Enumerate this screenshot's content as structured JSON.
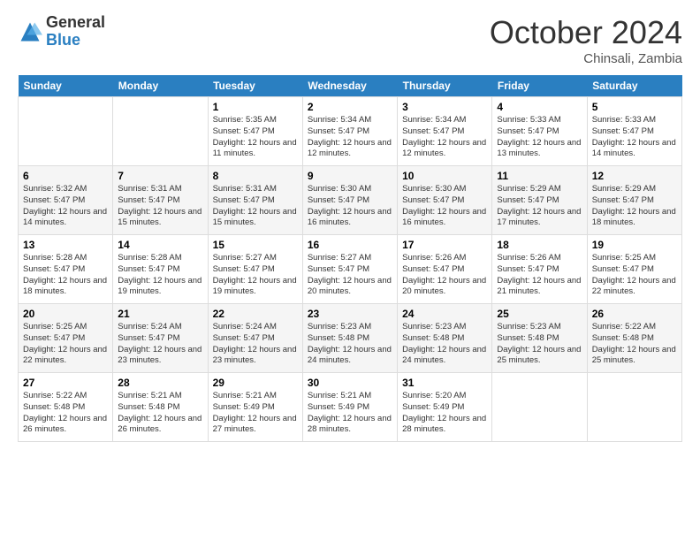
{
  "logo": {
    "general": "General",
    "blue": "Blue"
  },
  "header": {
    "month": "October 2024",
    "location": "Chinsali, Zambia"
  },
  "weekdays": [
    "Sunday",
    "Monday",
    "Tuesday",
    "Wednesday",
    "Thursday",
    "Friday",
    "Saturday"
  ],
  "weeks": [
    [
      {
        "day": "",
        "info": ""
      },
      {
        "day": "",
        "info": ""
      },
      {
        "day": "1",
        "info": "Sunrise: 5:35 AM\nSunset: 5:47 PM\nDaylight: 12 hours and 11 minutes."
      },
      {
        "day": "2",
        "info": "Sunrise: 5:34 AM\nSunset: 5:47 PM\nDaylight: 12 hours and 12 minutes."
      },
      {
        "day": "3",
        "info": "Sunrise: 5:34 AM\nSunset: 5:47 PM\nDaylight: 12 hours and 12 minutes."
      },
      {
        "day": "4",
        "info": "Sunrise: 5:33 AM\nSunset: 5:47 PM\nDaylight: 12 hours and 13 minutes."
      },
      {
        "day": "5",
        "info": "Sunrise: 5:33 AM\nSunset: 5:47 PM\nDaylight: 12 hours and 14 minutes."
      }
    ],
    [
      {
        "day": "6",
        "info": "Sunrise: 5:32 AM\nSunset: 5:47 PM\nDaylight: 12 hours and 14 minutes."
      },
      {
        "day": "7",
        "info": "Sunrise: 5:31 AM\nSunset: 5:47 PM\nDaylight: 12 hours and 15 minutes."
      },
      {
        "day": "8",
        "info": "Sunrise: 5:31 AM\nSunset: 5:47 PM\nDaylight: 12 hours and 15 minutes."
      },
      {
        "day": "9",
        "info": "Sunrise: 5:30 AM\nSunset: 5:47 PM\nDaylight: 12 hours and 16 minutes."
      },
      {
        "day": "10",
        "info": "Sunrise: 5:30 AM\nSunset: 5:47 PM\nDaylight: 12 hours and 16 minutes."
      },
      {
        "day": "11",
        "info": "Sunrise: 5:29 AM\nSunset: 5:47 PM\nDaylight: 12 hours and 17 minutes."
      },
      {
        "day": "12",
        "info": "Sunrise: 5:29 AM\nSunset: 5:47 PM\nDaylight: 12 hours and 18 minutes."
      }
    ],
    [
      {
        "day": "13",
        "info": "Sunrise: 5:28 AM\nSunset: 5:47 PM\nDaylight: 12 hours and 18 minutes."
      },
      {
        "day": "14",
        "info": "Sunrise: 5:28 AM\nSunset: 5:47 PM\nDaylight: 12 hours and 19 minutes."
      },
      {
        "day": "15",
        "info": "Sunrise: 5:27 AM\nSunset: 5:47 PM\nDaylight: 12 hours and 19 minutes."
      },
      {
        "day": "16",
        "info": "Sunrise: 5:27 AM\nSunset: 5:47 PM\nDaylight: 12 hours and 20 minutes."
      },
      {
        "day": "17",
        "info": "Sunrise: 5:26 AM\nSunset: 5:47 PM\nDaylight: 12 hours and 20 minutes."
      },
      {
        "day": "18",
        "info": "Sunrise: 5:26 AM\nSunset: 5:47 PM\nDaylight: 12 hours and 21 minutes."
      },
      {
        "day": "19",
        "info": "Sunrise: 5:25 AM\nSunset: 5:47 PM\nDaylight: 12 hours and 22 minutes."
      }
    ],
    [
      {
        "day": "20",
        "info": "Sunrise: 5:25 AM\nSunset: 5:47 PM\nDaylight: 12 hours and 22 minutes."
      },
      {
        "day": "21",
        "info": "Sunrise: 5:24 AM\nSunset: 5:47 PM\nDaylight: 12 hours and 23 minutes."
      },
      {
        "day": "22",
        "info": "Sunrise: 5:24 AM\nSunset: 5:47 PM\nDaylight: 12 hours and 23 minutes."
      },
      {
        "day": "23",
        "info": "Sunrise: 5:23 AM\nSunset: 5:48 PM\nDaylight: 12 hours and 24 minutes."
      },
      {
        "day": "24",
        "info": "Sunrise: 5:23 AM\nSunset: 5:48 PM\nDaylight: 12 hours and 24 minutes."
      },
      {
        "day": "25",
        "info": "Sunrise: 5:23 AM\nSunset: 5:48 PM\nDaylight: 12 hours and 25 minutes."
      },
      {
        "day": "26",
        "info": "Sunrise: 5:22 AM\nSunset: 5:48 PM\nDaylight: 12 hours and 25 minutes."
      }
    ],
    [
      {
        "day": "27",
        "info": "Sunrise: 5:22 AM\nSunset: 5:48 PM\nDaylight: 12 hours and 26 minutes."
      },
      {
        "day": "28",
        "info": "Sunrise: 5:21 AM\nSunset: 5:48 PM\nDaylight: 12 hours and 26 minutes."
      },
      {
        "day": "29",
        "info": "Sunrise: 5:21 AM\nSunset: 5:49 PM\nDaylight: 12 hours and 27 minutes."
      },
      {
        "day": "30",
        "info": "Sunrise: 5:21 AM\nSunset: 5:49 PM\nDaylight: 12 hours and 28 minutes."
      },
      {
        "day": "31",
        "info": "Sunrise: 5:20 AM\nSunset: 5:49 PM\nDaylight: 12 hours and 28 minutes."
      },
      {
        "day": "",
        "info": ""
      },
      {
        "day": "",
        "info": ""
      }
    ]
  ]
}
